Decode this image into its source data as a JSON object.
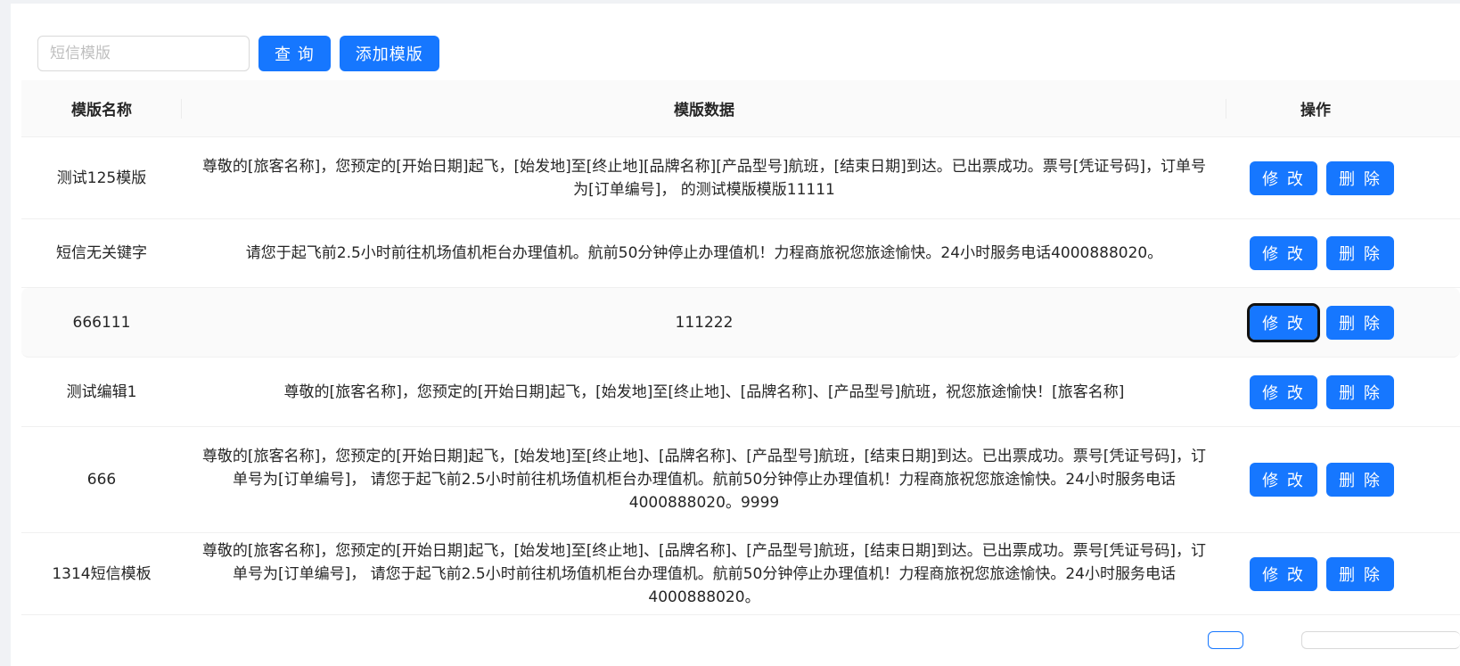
{
  "search": {
    "placeholder": "短信模版"
  },
  "toolbar": {
    "query_label": "查 询",
    "add_label": "添加模版"
  },
  "table": {
    "headers": {
      "name": "模版名称",
      "data": "模版数据",
      "actions": "操作"
    },
    "edit_label": "修 改",
    "delete_label": "删 除",
    "rows": [
      {
        "name": "测试125模版",
        "data": "尊敬的[旅客名称]，您预定的[开始日期]起飞，[始发地]至[终止地][品牌名称][产品型号]航班，[结束日期]到达。已出票成功。票号[凭证号码]，订单号为[订单编号]， 的测试模版模版11111"
      },
      {
        "name": "短信无关键字",
        "data": "请您于起飞前2.5小时前往机场值机柜台办理值机。航前50分钟停止办理值机！力程商旅祝您旅途愉快。24小时服务电话4000888020。"
      },
      {
        "name": "666111",
        "data": "111222"
      },
      {
        "name": "测试编辑1",
        "data": "尊敬的[旅客名称]，您预定的[开始日期]起飞，[始发地]至[终止地]、[品牌名称]、[产品型号]航班，祝您旅途愉快！[旅客名称]"
      },
      {
        "name": "666",
        "data": "尊敬的[旅客名称]，您预定的[开始日期]起飞，[始发地]至[终止地]、[品牌名称]、[产品型号]航班，[结束日期]到达。已出票成功。票号[凭证号码]，订单号为[订单编号]， 请您于起飞前2.5小时前往机场值机柜台办理值机。航前50分钟停止办理值机！力程商旅祝您旅途愉快。24小时服务电话4000888020。9999"
      },
      {
        "name": "1314短信模板",
        "data": "尊敬的[旅客名称]，您预定的[开始日期]起飞，[始发地]至[终止地]、[品牌名称]、[产品型号]航班，[结束日期]到达。已出票成功。票号[凭证号码]，订单号为[订单编号]， 请您于起飞前2.5小时前往机场值机柜台办理值机。航前50分钟停止办理值机！力程商旅祝您旅途愉快。24小时服务电话4000888020。"
      }
    ]
  },
  "colors": {
    "primary": "#1677ff",
    "header_bg": "#fafafa",
    "page_bg": "#f0f2f5"
  }
}
